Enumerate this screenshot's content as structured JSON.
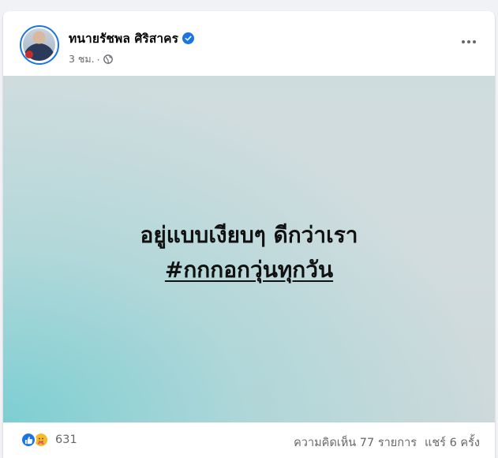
{
  "post": {
    "author_name": "ทนายรัชพล ศิริสาคร",
    "timestamp": "3 ชม.",
    "separator": "·",
    "icons": {
      "verified": "verified-badge-icon",
      "audience": "globe-icon",
      "more": "more-options-icon"
    },
    "colors": {
      "accent": "#1b74e4",
      "muted_text": "#65676b"
    }
  },
  "media": {
    "line1": "อยู่แบบเงียบๆ ดีกว่าเรา",
    "line2": "#กกกอกวุ่นทุกวัน"
  },
  "footer": {
    "reaction_icons": [
      "like-reaction-icon",
      "care-reaction-icon"
    ],
    "reaction_count": "631",
    "comments": "ความคิดเห็น 77 รายการ",
    "shares": "แชร์ 6 ครั้ง"
  }
}
